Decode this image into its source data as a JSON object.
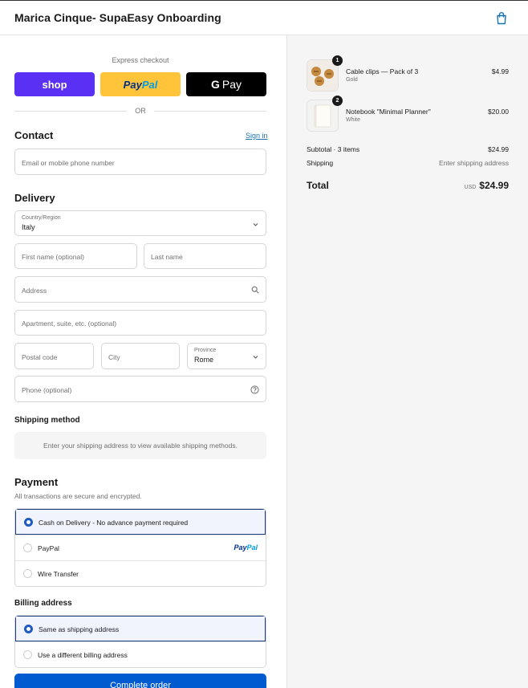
{
  "header": {
    "store_title": "Marica Cinque- SupaEasy Onboarding"
  },
  "express": {
    "label": "Express checkout",
    "shop_label": "shop",
    "paypal_part1": "Pay",
    "paypal_part2": "Pal",
    "gpay_g": "G",
    "gpay_label": "Pay",
    "or_label": "OR"
  },
  "contact": {
    "title": "Contact",
    "signin_label": "Sign in",
    "email_placeholder": "Email or mobile phone number"
  },
  "delivery": {
    "title": "Delivery",
    "country_label": "Country/Region",
    "country_value": "Italy",
    "first_name_placeholder": "First name (optional)",
    "last_name_placeholder": "Last name",
    "address_placeholder": "Address",
    "apartment_placeholder": "Apartment, suite, etc. (optional)",
    "postal_placeholder": "Postal code",
    "city_placeholder": "City",
    "province_label": "Province",
    "province_value": "Rome",
    "phone_placeholder": "Phone (optional)"
  },
  "shipping_method": {
    "title": "Shipping method",
    "message": "Enter your shipping address to view available shipping methods."
  },
  "payment": {
    "title": "Payment",
    "subtitle": "All transactions are secure and encrypted.",
    "options": [
      {
        "label": "Cash on Delivery - No advance payment required",
        "selected": true
      },
      {
        "label": "PayPal",
        "selected": false
      },
      {
        "label": "Wire Transfer",
        "selected": false
      }
    ],
    "paypal_logo_part1": "Pay",
    "paypal_logo_part2": "Pal"
  },
  "billing": {
    "title": "Billing address",
    "options": [
      {
        "label": "Same as shipping address",
        "selected": true
      },
      {
        "label": "Use a different billing address",
        "selected": false
      }
    ]
  },
  "complete_button": "Complete order",
  "order_summary": {
    "items": [
      {
        "name": "Cable clips — Pack of 3",
        "variant": "Gold",
        "price": "$4.99",
        "quantity": "1",
        "icon": "cable-clips-thumbnail"
      },
      {
        "name": "Notebook \"Minimal Planner\"",
        "variant": "White",
        "price": "$20.00",
        "quantity": "2",
        "icon": "notebook-thumbnail"
      }
    ],
    "subtotal_label": "Subtotal · 3 items",
    "subtotal_value": "$24.99",
    "shipping_label": "Shipping",
    "shipping_value": "Enter shipping address",
    "total_label": "Total",
    "currency": "USD",
    "total_value": "$24.99"
  },
  "colors": {
    "shop_purple": "#5a31f4",
    "paypal_yellow": "#ffc439",
    "primary_blue": "#005bd1",
    "link_blue": "#1773b0",
    "selected_bg": "#f2f4fd"
  }
}
